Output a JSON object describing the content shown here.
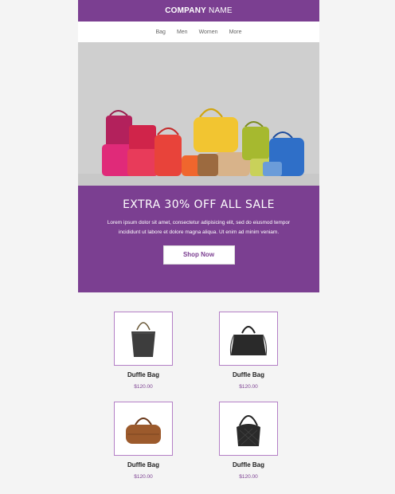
{
  "header": {
    "company_bold": "COMPANY",
    "company_rest": "NAME"
  },
  "nav": {
    "items": [
      "Bag",
      "Men",
      "Women",
      "More"
    ]
  },
  "hero": {
    "title": "EXTRA 30% OFF ALL SALE",
    "body": "Lorem ipsum dolor sit amet, consectetur adipisicing elit, sed do eiusmod tempor incididunt ut labore et dolore magna aliqua. Ut enim ad minim veniam.",
    "button": "Shop Now"
  },
  "products": [
    {
      "name": "Duffle Bag",
      "price": "$120.00",
      "icon": "black-tote-bag"
    },
    {
      "name": "Duffle Bag",
      "price": "$120.00",
      "icon": "black-satchel-bag"
    },
    {
      "name": "Duffle Bag",
      "price": "$120.00",
      "icon": "brown-duffle-bag"
    },
    {
      "name": "Duffle Bag",
      "price": "$120.00",
      "icon": "black-quilted-bag"
    }
  ],
  "colors": {
    "brand": "#7b3f91",
    "hero_bg": "#cfcfcf",
    "page_bg": "#f4f4f4"
  }
}
